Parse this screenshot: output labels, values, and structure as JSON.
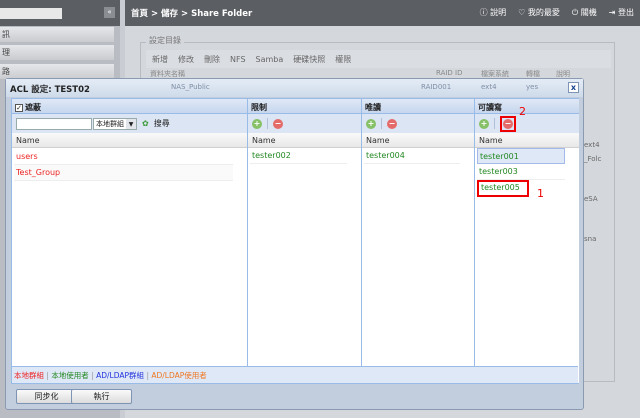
{
  "sidebar": {
    "items": [
      "訊",
      "理",
      "路"
    ],
    "collapse": "«"
  },
  "header": {
    "breadcrumb": "首頁 > 儲存 > Share Folder",
    "help": "說明",
    "favorites": "我的最愛",
    "shutdown": "關機",
    "logout": "登出"
  },
  "background": {
    "section_title": "設定目錄",
    "toolbar": [
      "新增",
      "修改",
      "刪除",
      "NFS",
      "Samba",
      "硬碟快照",
      "權限"
    ],
    "columns": [
      "資料夾名稱",
      "RAID ID",
      "檔案系統",
      "轉檔",
      "說明"
    ],
    "row": [
      "NAS_Public",
      "RAID001",
      "ext4",
      "yes"
    ],
    "side_fragments": [
      "ext4",
      "_Folc",
      "eSA",
      "sna"
    ]
  },
  "dialog": {
    "title_prefix": "ACL 設定:",
    "title_name": "TEST02",
    "close": "x",
    "filter": {
      "checkbox_label": "遮蔽",
      "search_value": "",
      "select_value": "本地群組",
      "search_label": "搜尋",
      "name_header": "Name",
      "items": [
        "users",
        "Test_Group"
      ]
    },
    "deny": {
      "title": "限制",
      "name_header": "Name",
      "items": [
        "tester002"
      ]
    },
    "readonly": {
      "title": "唯讀",
      "name_header": "Name",
      "items": [
        "tester004"
      ]
    },
    "writable": {
      "title": "可讀寫",
      "name_header": "Name",
      "items": [
        "tester001",
        "tester003",
        "tester005"
      ]
    },
    "annotations": {
      "step1": "1",
      "step2": "2"
    },
    "legend": {
      "local_group": "本地群組",
      "local_user": "本地使用者",
      "ad_group": "AD/LDAP群組",
      "ad_user": "AD/LDAP使用者",
      "sep": "|"
    },
    "buttons": {
      "sync": "同步化",
      "apply": "執行"
    }
  },
  "colors": {
    "group": "#ee2222",
    "user": "#228822",
    "ad_group": "#2233dd",
    "ad_user": "#ee7722",
    "highlight": "#ee0000"
  }
}
